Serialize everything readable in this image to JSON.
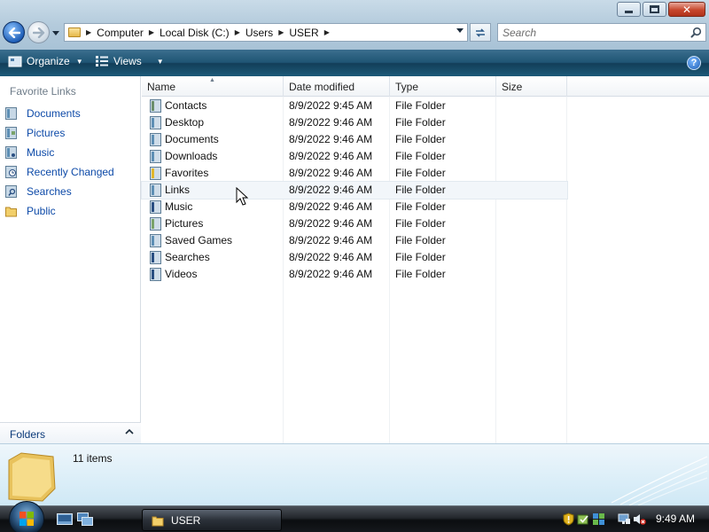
{
  "window": {
    "controls": {
      "minimize_icon": "minimize-icon",
      "maximize_icon": "maximize-icon",
      "close_icon": "close-icon",
      "close_glyph": "✕"
    }
  },
  "address_bar": {
    "breadcrumbs": [
      "Computer",
      "Local Disk (C:)",
      "Users",
      "USER"
    ]
  },
  "search": {
    "placeholder": "Search"
  },
  "command_bar": {
    "organize_label": "Organize",
    "views_label": "Views",
    "help_glyph": "?"
  },
  "nav_pane": {
    "title": "Favorite Links",
    "items": [
      {
        "label": "Documents",
        "icon": "documents-icon"
      },
      {
        "label": "Pictures",
        "icon": "pictures-icon"
      },
      {
        "label": "Music",
        "icon": "music-icon"
      },
      {
        "label": "Recently Changed",
        "icon": "recently-changed-icon"
      },
      {
        "label": "Searches",
        "icon": "searches-icon"
      },
      {
        "label": "Public",
        "icon": "public-folder-icon"
      }
    ],
    "folders_label": "Folders"
  },
  "file_list": {
    "columns": [
      "Name",
      "Date modified",
      "Type",
      "Size"
    ],
    "rows": [
      {
        "name": "Contacts",
        "date": "8/9/2022 9:45 AM",
        "type": "File Folder",
        "size": ""
      },
      {
        "name": "Desktop",
        "date": "8/9/2022 9:46 AM",
        "type": "File Folder",
        "size": ""
      },
      {
        "name": "Documents",
        "date": "8/9/2022 9:46 AM",
        "type": "File Folder",
        "size": ""
      },
      {
        "name": "Downloads",
        "date": "8/9/2022 9:46 AM",
        "type": "File Folder",
        "size": ""
      },
      {
        "name": "Favorites",
        "date": "8/9/2022 9:46 AM",
        "type": "File Folder",
        "size": ""
      },
      {
        "name": "Links",
        "date": "8/9/2022 9:46 AM",
        "type": "File Folder",
        "size": ""
      },
      {
        "name": "Music",
        "date": "8/9/2022 9:46 AM",
        "type": "File Folder",
        "size": ""
      },
      {
        "name": "Pictures",
        "date": "8/9/2022 9:46 AM",
        "type": "File Folder",
        "size": ""
      },
      {
        "name": "Saved Games",
        "date": "8/9/2022 9:46 AM",
        "type": "File Folder",
        "size": ""
      },
      {
        "name": "Searches",
        "date": "8/9/2022 9:46 AM",
        "type": "File Folder",
        "size": ""
      },
      {
        "name": "Videos",
        "date": "8/9/2022 9:46 AM",
        "type": "File Folder",
        "size": ""
      }
    ],
    "hovered_row": "Links"
  },
  "details_pane": {
    "item_count": "11 items"
  },
  "taskbar": {
    "task_button_label": "USER",
    "clock": "9:49 AM"
  },
  "colors": {
    "link_blue": "#0d4aa8",
    "command_bar": "#1f5574",
    "folder_yellow": "#e5b84b"
  }
}
